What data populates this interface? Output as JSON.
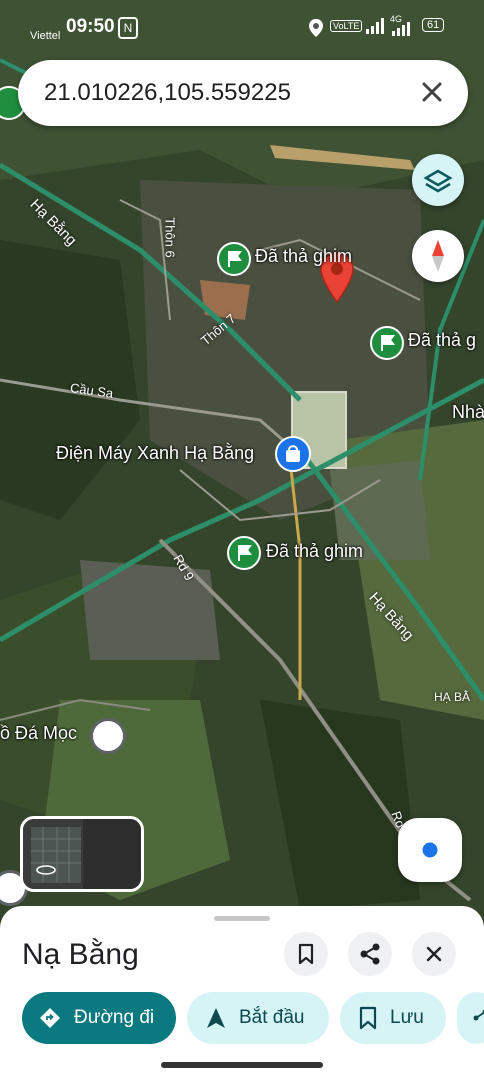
{
  "status_bar": {
    "carrier": "Viettel",
    "time": "09:50",
    "nfc": "N",
    "volte": "VoLTE",
    "network": "4G",
    "battery": "61"
  },
  "search": {
    "query": "21.010226,105.559225"
  },
  "map": {
    "labels": {
      "pin_top": "Đã thả ghim",
      "pin_right": "Đã thả g",
      "pin_bottom": "Đã thả ghim",
      "store": "Điện Máy Xanh Hạ Bằng",
      "place_left": "ồ Đá Mọc",
      "edge_right": "Nhà",
      "edge_right_2": "HẠ BẰ"
    },
    "roads": {
      "ha_bang_1": "Hạ Bằng",
      "thon6": "Thôn 6",
      "thon7": "Thôn 7",
      "cau_sa": "Cầu Sa",
      "rd9": "Rd 9",
      "ha_bang_2": "Hạ Bằng",
      "ro": "Ro"
    }
  },
  "sheet": {
    "title": "Nạ Bằng",
    "actions": {
      "directions": "Đường đi",
      "start": "Bắt đầu",
      "save": "Lưu"
    }
  },
  "colors": {
    "accent": "#0b7a80",
    "chip_bg": "#d6f3f5",
    "pin_green": "#1e8e3e",
    "red_pin": "#ea4335",
    "location_blue": "#1a73e8"
  }
}
